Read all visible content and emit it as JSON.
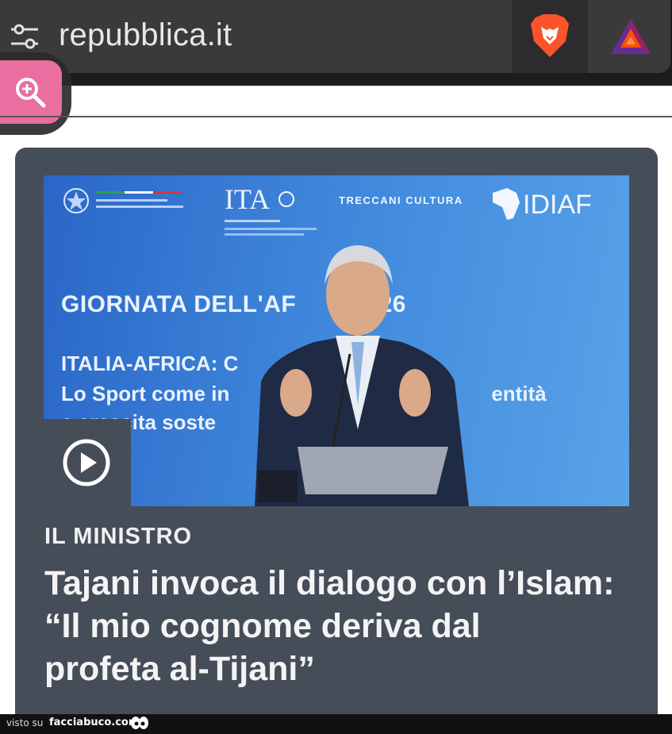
{
  "browser": {
    "url": "repubblica.it",
    "icons": {
      "settings": "tune-icon",
      "shields": "brave-lion-icon",
      "rewards": "bat-triangle-icon",
      "zoom": "zoom-in-icon"
    }
  },
  "article": {
    "kicker": "IL MINISTRO",
    "headline_lines": [
      "Tajani invoca il dialogo con l’Islam:",
      "“Il mio cognome deriva dal",
      "profeta al-Tijani”"
    ],
    "hero": {
      "title": "GIORNATA DELL'AF",
      "title_year": "2026",
      "line1": "ITALIA-AFRICA: C",
      "line2_left": "Lo Sport come in",
      "line2_right": "entità",
      "line3": "e crescita soste",
      "logos": {
        "ita": "ITA",
        "treccani": "TRECCANI CULTURA",
        "idiaf": "IDIAF"
      }
    },
    "play_icon": "play-circle-icon"
  },
  "footer": {
    "visto": "visto su",
    "site": "facciabuco.com"
  },
  "colors": {
    "card_bg": "#454d59",
    "zoom_pink": "#e86f9f",
    "brave_orange": "#fb542b"
  }
}
